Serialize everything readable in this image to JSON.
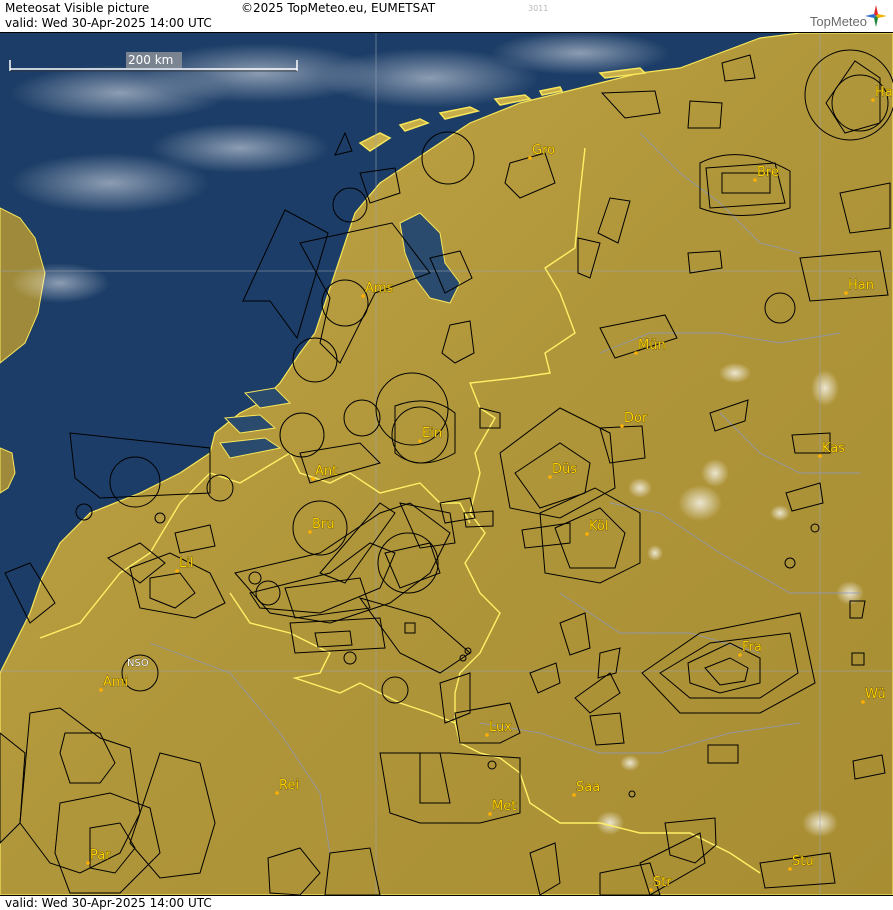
{
  "header": {
    "title": "Meteosat Visible picture",
    "valid": "valid:  Wed  30-Apr-2025  14:00 UTC",
    "copyright": "©2025 TopMeteo.eu, EUMETSAT",
    "code": "3011",
    "brand": "TopMeteo"
  },
  "scale_bar": {
    "label": "200 km"
  },
  "footer": {
    "valid": "valid:  Wed  30-Apr-2025  14:00 UTC"
  },
  "colors": {
    "sea": "#1b3a63",
    "land": "#b59a3a",
    "border_yellow": "#fff066",
    "city_label": "#ffd400",
    "airspace": "#000000"
  },
  "cities": [
    {
      "label": "Gro"
    },
    {
      "label": "Bre"
    },
    {
      "label": "Ha"
    },
    {
      "label": "Ams"
    },
    {
      "label": "Han"
    },
    {
      "label": "Mün"
    },
    {
      "label": "Dor"
    },
    {
      "label": "Ein"
    },
    {
      "label": "Kas"
    },
    {
      "label": "Ant"
    },
    {
      "label": "Düs"
    },
    {
      "label": "Bru"
    },
    {
      "label": "Köl"
    },
    {
      "label": "Lil"
    },
    {
      "label": "Fra"
    },
    {
      "label": "NSO"
    },
    {
      "label": "Ami"
    },
    {
      "label": "Wü"
    },
    {
      "label": "Lux"
    },
    {
      "label": "Rei"
    },
    {
      "label": "Saa"
    },
    {
      "label": "Met"
    },
    {
      "label": "Par"
    },
    {
      "label": "Stu"
    },
    {
      "label": "Str"
    }
  ]
}
